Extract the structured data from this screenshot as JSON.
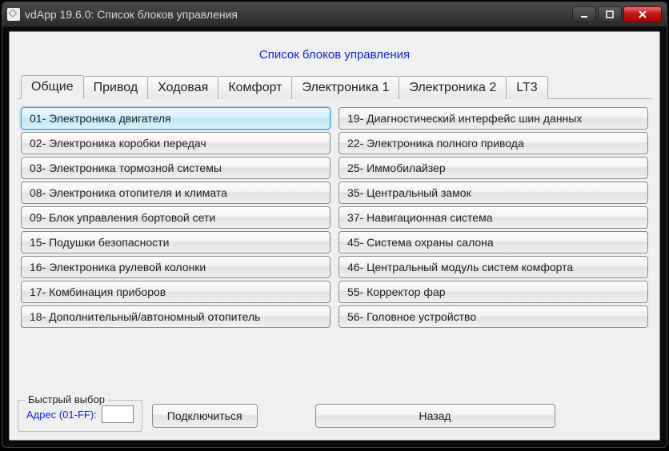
{
  "window": {
    "title": "vdApp 19.6.0:  Список блоков управления"
  },
  "page_title": "Список блоков управления",
  "tabs": [
    {
      "label": "Общие",
      "active": true
    },
    {
      "label": "Привод",
      "active": false
    },
    {
      "label": "Ходовая",
      "active": false
    },
    {
      "label": "Комфорт",
      "active": false
    },
    {
      "label": "Электроника 1",
      "active": false
    },
    {
      "label": "Электроника 2",
      "active": false
    },
    {
      "label": "LT3",
      "active": false
    }
  ],
  "blocks_left": [
    {
      "label": "01- Электроника двигателя",
      "selected": true
    },
    {
      "label": "02- Электроника коробки передач",
      "selected": false
    },
    {
      "label": "03- Электроника тормозной системы",
      "selected": false
    },
    {
      "label": "08- Электроника отопителя и климата",
      "selected": false
    },
    {
      "label": "09- Блок управления бортовой сети",
      "selected": false
    },
    {
      "label": "15- Подушки безопасности",
      "selected": false
    },
    {
      "label": "16- Электроника рулевой колонки",
      "selected": false
    },
    {
      "label": "17- Комбинация приборов",
      "selected": false
    },
    {
      "label": "18- Дополнительный/автономный отопитель",
      "selected": false
    }
  ],
  "blocks_right": [
    {
      "label": "19- Диагностический интерфейс шин данных",
      "selected": false
    },
    {
      "label": "22- Электроника полного привода",
      "selected": false
    },
    {
      "label": "25- Иммобилайзер",
      "selected": false
    },
    {
      "label": "35- Центральный замок",
      "selected": false
    },
    {
      "label": "37- Навигационная система",
      "selected": false
    },
    {
      "label": "45- Система охраны салона",
      "selected": false
    },
    {
      "label": "46- Центральный модуль систем комфорта",
      "selected": false
    },
    {
      "label": "55- Корректор фар",
      "selected": false
    },
    {
      "label": "56- Головное устройство",
      "selected": false
    }
  ],
  "quick": {
    "legend": "Быстрый выбор",
    "label": "Адрес (01-FF):",
    "value": "",
    "connect": "Подключиться"
  },
  "back": "Назад"
}
